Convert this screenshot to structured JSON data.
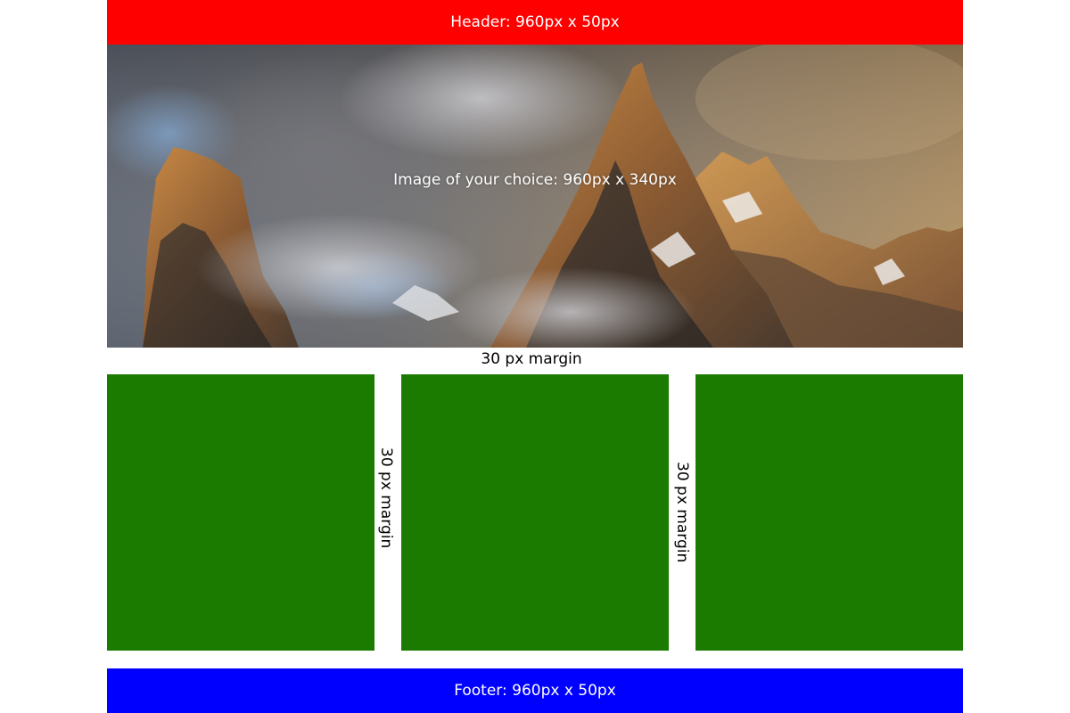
{
  "header": {
    "label": "Header: 960px x 50px",
    "color": "#ff0000"
  },
  "hero": {
    "caption": "Image of your choice: 960px x 340px",
    "image": "mountain-peaks-in-clouds"
  },
  "margins": {
    "top_label": "30 px margin",
    "between_1_2": "30 px margin",
    "between_2_3": "30 px margin"
  },
  "boxes": {
    "color": "#1b7b00",
    "count": 3
  },
  "footer": {
    "label": "Footer: 960px x 50px",
    "color": "#0000ff"
  }
}
